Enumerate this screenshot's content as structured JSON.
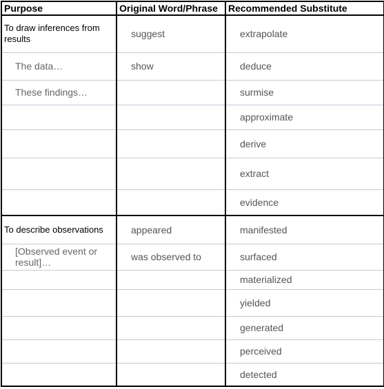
{
  "headers": {
    "purpose": "Purpose",
    "original": "Original Word/Phrase",
    "substitute": "Recommended Substitute"
  },
  "sections": [
    {
      "rows": [
        {
          "purpose": "To draw inferences from results",
          "original": "suggest",
          "substitute": "extrapolate"
        },
        {
          "purpose": "The data…",
          "original": "show",
          "substitute": "deduce"
        },
        {
          "purpose": "These findings…",
          "original": "",
          "substitute": "surmise"
        },
        {
          "purpose": "",
          "original": "",
          "substitute": "approximate"
        },
        {
          "purpose": "",
          "original": "",
          "substitute": "derive"
        },
        {
          "purpose": "",
          "original": "",
          "substitute": "extract"
        },
        {
          "purpose": "",
          "original": "",
          "substitute": "evidence"
        }
      ]
    },
    {
      "rows": [
        {
          "purpose": "To describe observations",
          "original": "appeared",
          "substitute": "manifested"
        },
        {
          "purpose": "[Observed event or result]…",
          "original": "was observed to",
          "substitute": "surfaced"
        },
        {
          "purpose": "",
          "original": "",
          "substitute": "materialized"
        },
        {
          "purpose": "",
          "original": "",
          "substitute": "yielded"
        },
        {
          "purpose": "",
          "original": "",
          "substitute": "generated"
        },
        {
          "purpose": "",
          "original": "",
          "substitute": "perceived"
        },
        {
          "purpose": "",
          "original": "",
          "substitute": "detected"
        }
      ]
    }
  ]
}
